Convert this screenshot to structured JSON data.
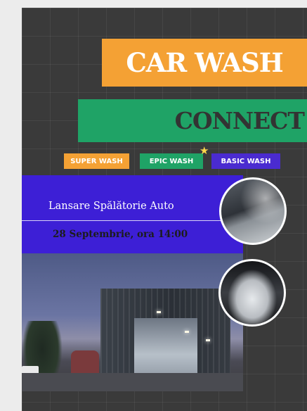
{
  "poster": {
    "title": "CAR WASH",
    "subtitle": "CONNECT",
    "badges": [
      "SUPER WASH",
      "EPIC WASH",
      "BASIC WASH"
    ],
    "banner_title": "Lansare Spălătorie Auto",
    "banner_date": "28 Septembrie, ora 14:00"
  },
  "colors": {
    "orange": "#f4a134",
    "green": "#1fa366",
    "purple": "#3d1fd6",
    "background": "#3a3a3a"
  }
}
